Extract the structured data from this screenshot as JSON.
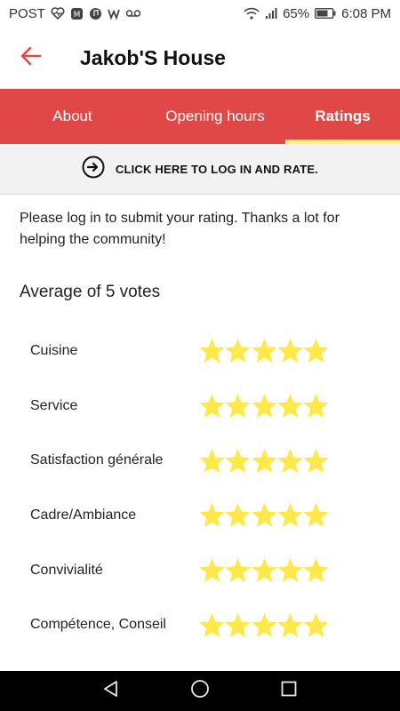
{
  "status_bar": {
    "app_label": "POST",
    "battery": "65%",
    "time": "6:08 PM"
  },
  "header": {
    "title": "Jakob'S House"
  },
  "tabs": [
    {
      "label": "About",
      "active": false
    },
    {
      "label": "Opening hours",
      "active": false
    },
    {
      "label": "Ratings",
      "active": true
    }
  ],
  "login_bar": {
    "label": "CLICK HERE TO LOG IN AND RATE."
  },
  "info": {
    "message": "Please log in to submit your rating. Thanks a lot for helping the community!"
  },
  "ratings": {
    "average_label": "Average of 5 votes",
    "max_stars": 5,
    "star_color": "#ffe94a",
    "items": [
      {
        "label": "Cuisine",
        "stars": 5
      },
      {
        "label": "Service",
        "stars": 5
      },
      {
        "label": "Satisfaction générale",
        "stars": 5
      },
      {
        "label": "Cadre/Ambiance",
        "stars": 5
      },
      {
        "label": "Convivialité",
        "stars": 5
      },
      {
        "label": "Compétence, Conseil",
        "stars": 5
      }
    ]
  },
  "colors": {
    "accent": "#e04848",
    "tab_indicator": "#fff27a"
  }
}
